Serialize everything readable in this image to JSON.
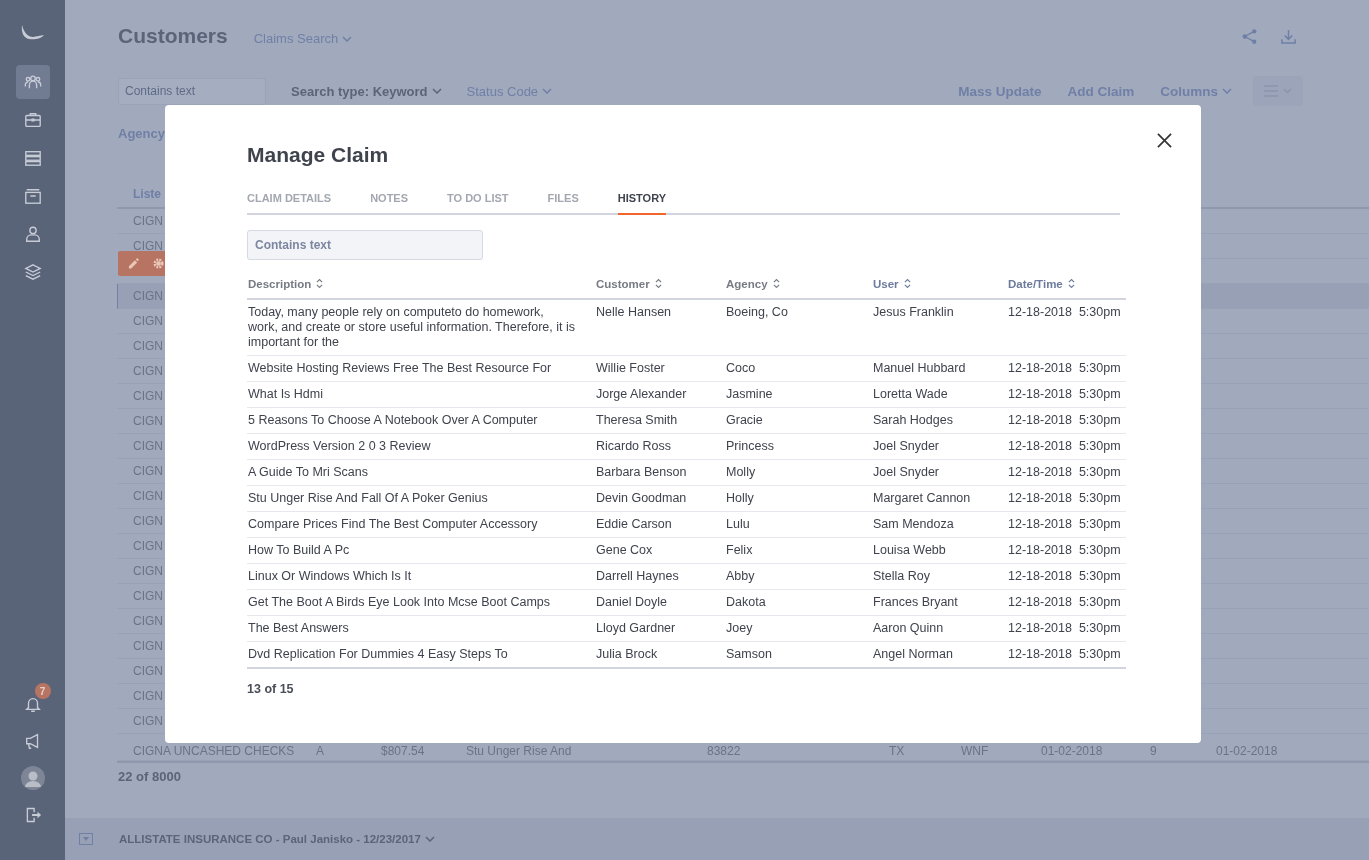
{
  "sidebar": {
    "items": [
      {
        "kind": "people",
        "selected": true
      },
      {
        "kind": "briefcase",
        "selected": false
      },
      {
        "kind": "server",
        "selected": false
      },
      {
        "kind": "archive",
        "selected": false
      },
      {
        "kind": "user",
        "selected": false
      },
      {
        "kind": "layers",
        "selected": false
      }
    ],
    "notifications_badge": "7"
  },
  "header": {
    "title": "Customers",
    "view_menu": "Claims Search"
  },
  "toolbar": {
    "search_placeholder": "Contains text",
    "search_type": "Search type: Keyword",
    "status_filter": "Status Code",
    "actions": [
      "Mass Update",
      "Add Claim"
    ],
    "columns_menu": "Columns"
  },
  "filters": {
    "label": "Agency"
  },
  "table": {
    "column_1": "Liste",
    "rows": [
      {
        "kind": "text",
        "text": "CIGN",
        "selected": false
      },
      {
        "kind": "text",
        "text": "CIGN",
        "selected": false
      },
      {
        "kind": "actions",
        "selected": false
      },
      {
        "kind": "text",
        "text": "CIGN",
        "selected": true
      },
      {
        "kind": "text",
        "text": "CIGN",
        "selected": false
      },
      {
        "kind": "text",
        "text": "CIGN",
        "selected": false
      },
      {
        "kind": "text",
        "text": "CIGN",
        "selected": false
      },
      {
        "kind": "text",
        "text": "CIGN",
        "selected": false
      },
      {
        "kind": "text",
        "text": "CIGN",
        "selected": false
      },
      {
        "kind": "text",
        "text": "CIGN",
        "selected": false
      },
      {
        "kind": "text",
        "text": "CIGN",
        "selected": false
      },
      {
        "kind": "text",
        "text": "CIGN",
        "selected": false
      },
      {
        "kind": "text",
        "text": "CIGN",
        "selected": false
      },
      {
        "kind": "text",
        "text": "CIGN",
        "selected": false
      },
      {
        "kind": "text",
        "text": "CIGN",
        "selected": false
      },
      {
        "kind": "text",
        "text": "CIGN",
        "selected": false
      },
      {
        "kind": "text",
        "text": "CIGN",
        "selected": false
      },
      {
        "kind": "text",
        "text": "CIGN",
        "selected": false
      },
      {
        "kind": "text",
        "text": "CIGN",
        "selected": false
      },
      {
        "kind": "text",
        "text": "CIGN",
        "selected": false
      },
      {
        "kind": "text",
        "text": "CIGN",
        "selected": false
      },
      {
        "kind": "full",
        "cells": [
          "CIGNA UNCASHED CHECKS",
          "A",
          "$807.54",
          "Stu Unger Rise And",
          "83822",
          "TX",
          "WNF",
          "01-02-2018",
          "9",
          "01-02-2018"
        ],
        "selected": false
      }
    ],
    "count": "22 of 8000"
  },
  "bottom_bar": {
    "label": "ALLISTATE INSURANCE CO - Paul Janisko - 12/23/2017"
  },
  "modal": {
    "title": "Manage Claim",
    "tabs": [
      {
        "label": "CLAIM DETAILS",
        "selected": false
      },
      {
        "label": "NOTES",
        "selected": false
      },
      {
        "label": "TO DO LIST",
        "selected": false
      },
      {
        "label": "FILES",
        "selected": false
      },
      {
        "label": "HISTORY",
        "selected": true
      }
    ],
    "search_placeholder": "Contains text",
    "columns": [
      {
        "label": "Description",
        "accent": false
      },
      {
        "label": "Customer",
        "accent": false
      },
      {
        "label": "Agency",
        "accent": false
      },
      {
        "label": "User",
        "accent": true
      },
      {
        "label": "Date/Time",
        "accent": true
      }
    ],
    "rows": [
      [
        "Today, many people rely on computeto do homework, work, and create or store useful information. Therefore, it is important for the",
        "Nelle Hansen",
        "Boeing, Co",
        "Jesus Franklin",
        "12-18-2018  5:30pm"
      ],
      [
        "Website Hosting Reviews Free The Best Resource For",
        "Willie Foster",
        "Coco",
        "Manuel Hubbard",
        "12-18-2018  5:30pm"
      ],
      [
        "What Is Hdmi",
        "Jorge Alexander",
        "Jasmine",
        "Loretta Wade",
        "12-18-2018  5:30pm"
      ],
      [
        "5 Reasons To Choose A Notebook Over A Computer",
        "Theresa Smith",
        "Gracie",
        "Sarah Hodges",
        "12-18-2018  5:30pm"
      ],
      [
        "WordPress Version 2 0 3 Review",
        "Ricardo Ross",
        "Princess",
        "Joel Snyder",
        "12-18-2018  5:30pm"
      ],
      [
        "A Guide To Mri Scans",
        "Barbara Benson",
        "Molly",
        "Joel Snyder",
        "12-18-2018  5:30pm"
      ],
      [
        "Stu Unger Rise And Fall Of A Poker Genius",
        "Devin Goodman",
        "Holly",
        "Margaret Cannon",
        "12-18-2018  5:30pm"
      ],
      [
        "Compare Prices Find The Best Computer Accessory",
        "Eddie Carson",
        "Lulu",
        "Sam Mendoza",
        "12-18-2018  5:30pm"
      ],
      [
        "How To Build A Pc",
        "Gene Cox",
        "Felix",
        "Louisa Webb",
        "12-18-2018  5:30pm"
      ],
      [
        "Linux Or Windows Which Is It",
        "Darrell Haynes",
        "Abby",
        "Stella Roy",
        "12-18-2018  5:30pm"
      ],
      [
        "Get The Boot A Birds Eye Look Into Mcse Boot Camps",
        "Daniel Doyle",
        "Dakota",
        "Frances Bryant",
        "12-18-2018  5:30pm"
      ],
      [
        "The Best Answers",
        "Lloyd Gardner",
        "Joey",
        "Aaron Quinn",
        "12-18-2018  5:30pm"
      ],
      [
        "Dvd Replication For Dummies 4 Easy Steps To",
        "Julia Brock",
        "Samson",
        "Angel Norman",
        "12-18-2018  5:30pm"
      ]
    ],
    "count": "13 of 15"
  }
}
